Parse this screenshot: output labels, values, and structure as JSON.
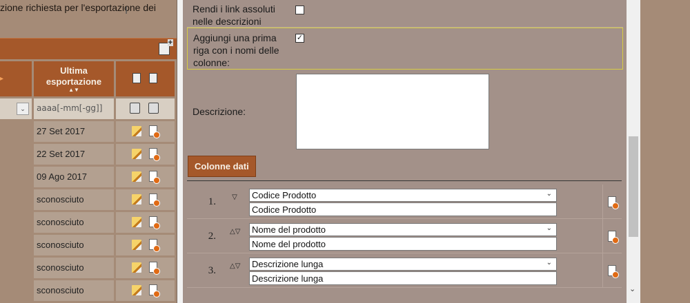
{
  "background": {
    "intro_text": "zione richiesta per l'esportazione dei",
    "cursor_glyph": "I",
    "table": {
      "headers": {
        "prev_arrow": "▸",
        "last_export": "Ultima esportazione",
        "sort_glyph": "▲▼"
      },
      "filter": {
        "date_placeholder": "aaaa[-mm[-gg]]",
        "select_chevron": "⌄"
      },
      "rows": [
        {
          "date": "27 Set 2017"
        },
        {
          "date": "22 Set 2017"
        },
        {
          "date": "09 Ago 2017"
        },
        {
          "date": "sconosciuto"
        },
        {
          "date": "sconosciuto"
        },
        {
          "date": "sconosciuto"
        },
        {
          "date": "sconosciuto"
        },
        {
          "date": "sconosciuto"
        }
      ]
    }
  },
  "modal": {
    "options": {
      "absolute_links_label": "Rendi i link assoluti nelle descrizioni",
      "absolute_links_checked": false,
      "header_row_label": "Aggiungi una prima riga con i nomi delle colonne:",
      "header_row_checked": true,
      "checkmark": "✓"
    },
    "description": {
      "label": "Descrizione:",
      "value": ""
    },
    "columns_tab": "Colonne dati",
    "columns": [
      {
        "num": "1.",
        "arrows": "▽",
        "select": "Codice Prodotto",
        "input": "Codice Prodotto"
      },
      {
        "num": "2.",
        "arrows": "△▽",
        "select": "Nome del prodotto",
        "input": "Nome del prodotto"
      },
      {
        "num": "3.",
        "arrows": "△▽",
        "select": "Descrizione lunga",
        "input": "Descrizione lunga"
      }
    ],
    "chevron": "⌄",
    "scroll_down": "⌄"
  }
}
